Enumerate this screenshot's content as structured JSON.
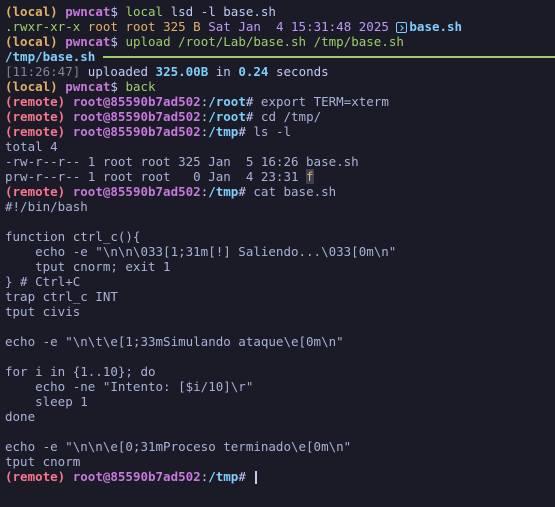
{
  "prompts": {
    "local": "(local)",
    "local_user": "pwncat",
    "local_sym": "$",
    "remote": "(remote)",
    "remote_user": "root@85590b7ad502",
    "remote_sym": "#",
    "path_root": "/root",
    "path_tmp": "/tmp"
  },
  "commands": {
    "c1_word": "local",
    "c1_rest": " lsd -l base.sh",
    "c2_word": "upload",
    "c2_rest": " /root/Lab/base.sh /tmp/base.sh",
    "c3": "back",
    "c4": "export TERM=xterm",
    "c5": "cd /tmp/",
    "c6": "ls -l",
    "c7": "cat base.sh"
  },
  "lsd": {
    "perms": ".rwxr-xr-x",
    "owner": "root",
    "group": "root",
    "size": "325 B",
    "date": "Sat Jan  4 15:31:48 2025",
    "name": "base.sh"
  },
  "upload": {
    "path": "/tmp/base.sh",
    "progress": 1.0,
    "time": "[11:26:47]",
    "uploaded": "uploaded",
    "amount": "325.00B",
    "in": "in",
    "seconds_val": "0.24",
    "seconds": "seconds"
  },
  "ls": {
    "total": "total 4",
    "row1": "-rw-r--r-- 1 root root 325 Jan  5 16:26 base.sh",
    "row2_prefix": "prw-r--r-- 1 root root   0 Jan  4 23:31 ",
    "row2_name": "f"
  },
  "script_lines": [
    "#!/bin/bash",
    "",
    "function ctrl_c(){",
    "    echo -e \"\\n\\n\\033[1;31m[!] Saliendo...\\033[0m\\n\"",
    "    tput cnorm; exit 1",
    "} # Ctrl+C",
    "trap ctrl_c INT",
    "tput civis",
    "",
    "echo -e \"\\n\\t\\e[1;33mSimulando ataque\\e[0m\\n\"",
    "",
    "for i in {1..10}; do",
    "    echo -ne \"Intento: [$i/10]\\r\"",
    "    sleep 1",
    "done",
    "",
    "echo -e \"\\n\\n\\e[0;31mProceso terminado\\e[0m\\n\"",
    "tput cnorm"
  ],
  "icons": {
    "file": "file-icon"
  },
  "colors": {
    "background": "#1a1b26",
    "local_prompt": "#e0af68",
    "user": "#c678dd",
    "remote_prompt": "#f7768e",
    "path": "#7dcfff",
    "success": "#9ece6a"
  }
}
